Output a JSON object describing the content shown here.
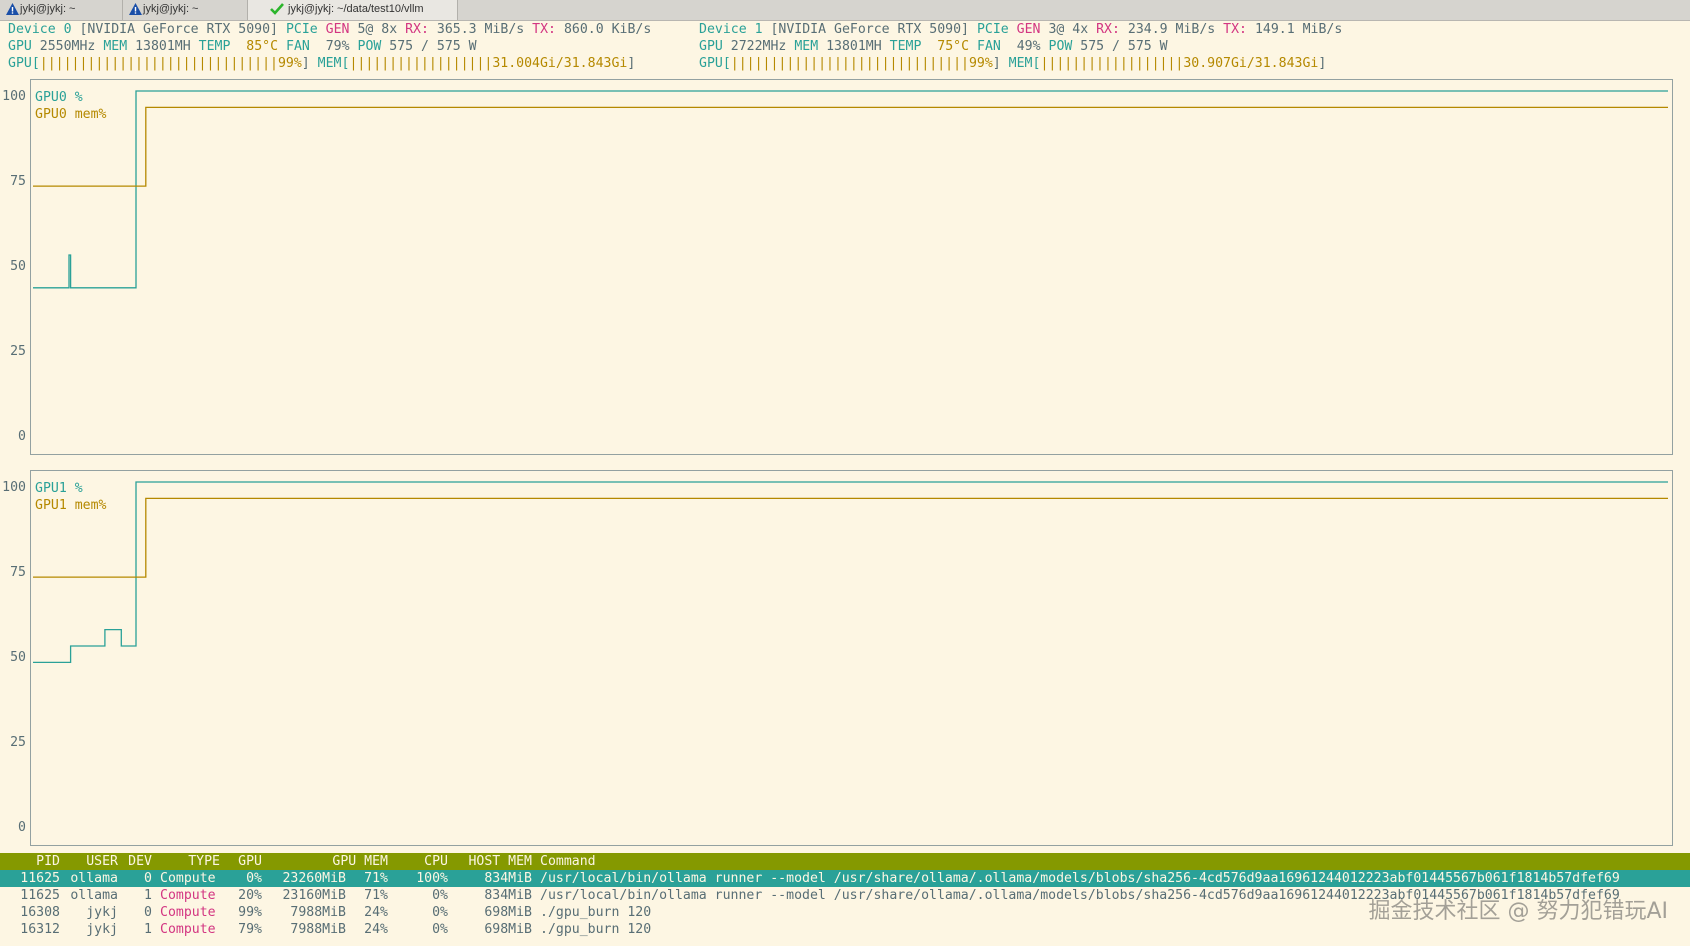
{
  "tabs": [
    {
      "label": "jykj@jykj: ~",
      "icon": "warning-icon"
    },
    {
      "label": "jykj@jykj: ~",
      "icon": "warning-icon"
    },
    {
      "label": "jykj@jykj: ~/data/test10/vllm",
      "icon": "checkmark-icon"
    }
  ],
  "devices": [
    {
      "label": "Device 0",
      "name": "[NVIDIA GeForce RTX 5090]",
      "pcie": "PCIe",
      "gen": "GEN",
      "gen_val": "5@ 8x",
      "rx_label": "RX:",
      "rx": "365.3 MiB/s",
      "tx_label": "TX:",
      "tx": "860.0 KiB/s",
      "gpu_label": "GPU",
      "gpu_clock": "2550MHz",
      "mem_label": "MEM",
      "mem_clock": "13801MH",
      "temp_label": "TEMP",
      "temp": "85°C",
      "fan_label": "FAN",
      "fan": "79%",
      "pow_label": "POW",
      "pow": "575 / 575 W",
      "gpu_bar_label": "GPU[",
      "gpu_bar": "||||||||||||||||||||||||||||||99%",
      "mem_bar_label": "MEM[",
      "mem_bar": "||||||||||||||||||31.004Gi/31.843Gi",
      "gpu_util_pct": 99,
      "mem_used_fraction": 0.974
    },
    {
      "label": "Device 1",
      "name": "[NVIDIA GeForce RTX 5090]",
      "pcie": "PCIe",
      "gen": "GEN",
      "gen_val": "3@ 4x",
      "rx_label": "RX:",
      "rx": "234.9 MiB/s",
      "tx_label": "TX:",
      "tx": "149.1 MiB/s",
      "gpu_label": "GPU",
      "gpu_clock": "2722MHz",
      "mem_label": "MEM",
      "mem_clock": "13801MH",
      "temp_label": "TEMP",
      "temp": "75°C",
      "fan_label": "FAN",
      "fan": "49%",
      "pow_label": "POW",
      "pow": "575 / 575 W",
      "gpu_bar_label": "GPU[",
      "gpu_bar": "||||||||||||||||||||||||||||||99%",
      "mem_bar_label": "MEM[",
      "mem_bar": "||||||||||||||||||30.907Gi/31.843Gi",
      "gpu_util_pct": 99,
      "mem_used_fraction": 0.971
    }
  ],
  "y_ticks": [
    "100",
    "75",
    "50",
    "25",
    "0"
  ],
  "chart_data": [
    {
      "type": "line",
      "ylim": [
        0,
        100
      ],
      "series": [
        {
          "name": "GPU0 %",
          "color": "#2aa198",
          "points": [
            [
              0,
              40
            ],
            [
              0.022,
              40
            ],
            [
              0.022,
              50
            ],
            [
              0.023,
              50
            ],
            [
              0.023,
              40
            ],
            [
              0.063,
              40
            ],
            [
              0.063,
              100
            ],
            [
              1,
              100
            ]
          ]
        },
        {
          "name": "GPU0 mem%",
          "color": "#b58900",
          "points": [
            [
              0,
              71
            ],
            [
              0.069,
              71
            ],
            [
              0.069,
              95
            ],
            [
              1,
              95
            ]
          ]
        }
      ]
    },
    {
      "type": "line",
      "ylim": [
        0,
        100
      ],
      "series": [
        {
          "name": "GPU1 %",
          "color": "#2aa198",
          "points": [
            [
              0,
              45
            ],
            [
              0.023,
              45
            ],
            [
              0.023,
              50
            ],
            [
              0.044,
              50
            ],
            [
              0.044,
              55
            ],
            [
              0.054,
              55
            ],
            [
              0.054,
              50
            ],
            [
              0.063,
              50
            ],
            [
              0.063,
              100
            ],
            [
              1,
              100
            ]
          ]
        },
        {
          "name": "GPU1 mem%",
          "color": "#b58900",
          "points": [
            [
              0,
              71
            ],
            [
              0.069,
              71
            ],
            [
              0.069,
              95
            ],
            [
              1,
              95
            ]
          ]
        }
      ]
    }
  ],
  "process_table": {
    "headers": [
      "PID",
      "USER",
      "DEV",
      "TYPE",
      "GPU",
      "GPU MEM",
      "CPU",
      "HOST MEM",
      "Command"
    ],
    "rows": [
      [
        "11625",
        "ollama",
        "0",
        "Compute",
        "0%",
        "23260MiB",
        "71%",
        "100%",
        "834MiB",
        "/usr/local/bin/ollama runner --model /usr/share/ollama/.ollama/models/blobs/sha256-4cd576d9aa16961244012223abf01445567b061f1814b57dfef69"
      ],
      [
        "11625",
        "ollama",
        "1",
        "Compute",
        "20%",
        "23160MiB",
        "71%",
        "0%",
        "834MiB",
        "/usr/local/bin/ollama runner --model /usr/share/ollama/.ollama/models/blobs/sha256-4cd576d9aa16961244012223abf01445567b061f1814b57dfef69"
      ],
      [
        "16308",
        "jykj",
        "0",
        "Compute",
        "99%",
        "7988MiB",
        "24%",
        "0%",
        "698MiB",
        "./gpu_burn 120"
      ],
      [
        "16312",
        "jykj",
        "1",
        "Compute",
        "79%",
        "7988MiB",
        "24%",
        "0%",
        "698MiB",
        "./gpu_burn 120"
      ]
    ]
  },
  "watermark": "掘金技术社区 @ 努力犯错玩AI"
}
